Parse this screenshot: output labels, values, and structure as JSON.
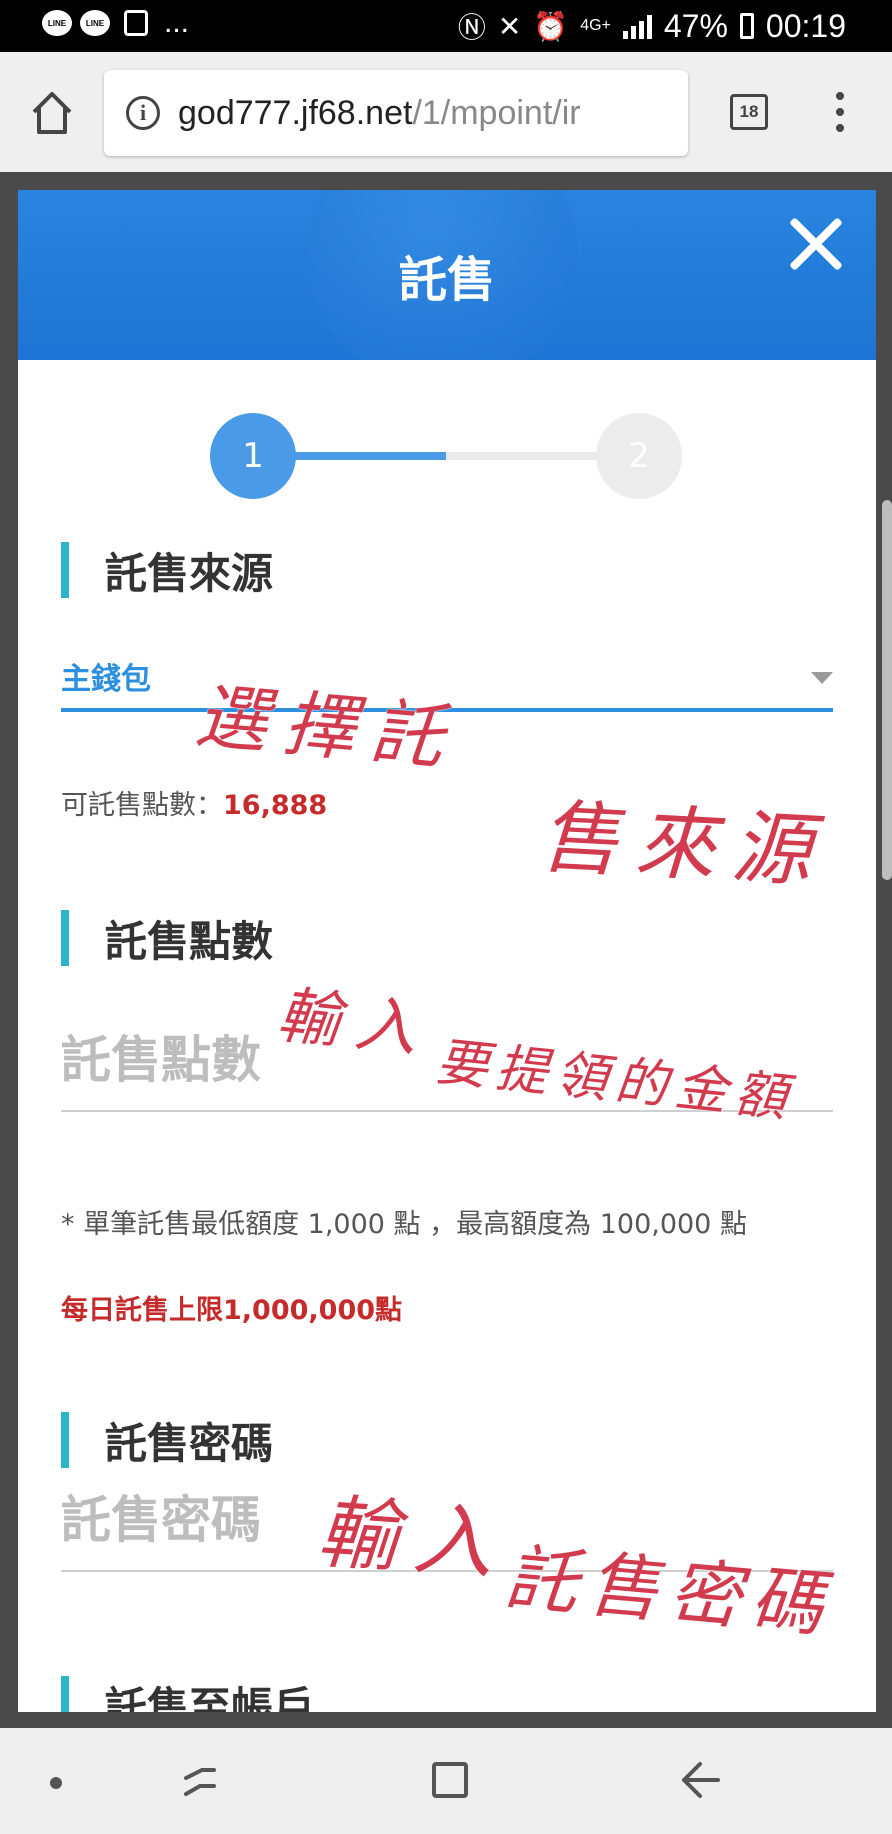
{
  "status_bar": {
    "line_badge_1": "LINE",
    "line_badge_2": "LINE",
    "more": "...",
    "network": "4G+",
    "battery": "47%",
    "time": "00:19"
  },
  "browser": {
    "url_host": "god777.jf68.net",
    "url_path": "/1/mpoint/ir",
    "tab_count": "18"
  },
  "modal": {
    "title": "託售",
    "steps": [
      "1",
      "2"
    ],
    "current_step": 1,
    "source_section": {
      "title": "託售來源",
      "selected": "主錢包",
      "available_label": "可託售點數：",
      "available_value": "16,888"
    },
    "points_section": {
      "title": "託售點數",
      "placeholder": "託售點數",
      "note": "* 單筆託售最低額度 1,000 點 ，最高額度為 100,000 點",
      "daily_limit": "每日託售上限1,000,000點"
    },
    "password_section": {
      "title": "託售密碼",
      "placeholder": "託售密碼"
    },
    "account_section": {
      "title": "託售至帳戶"
    }
  },
  "annotations": {
    "select_source_line1": "選擇託",
    "select_source_line2": "售來源",
    "enter_amount_line1": "輸入",
    "enter_amount_line2": "要提領的金額",
    "enter_password_line1": "輸入",
    "enter_password_line2": "託售密碼"
  },
  "colors": {
    "header_blue": "#1e74d4",
    "accent_blue": "#2d8fe0",
    "section_bar": "#2bb6c8",
    "red_text": "#c62b2b",
    "annotation_red": "#d23a4e"
  }
}
